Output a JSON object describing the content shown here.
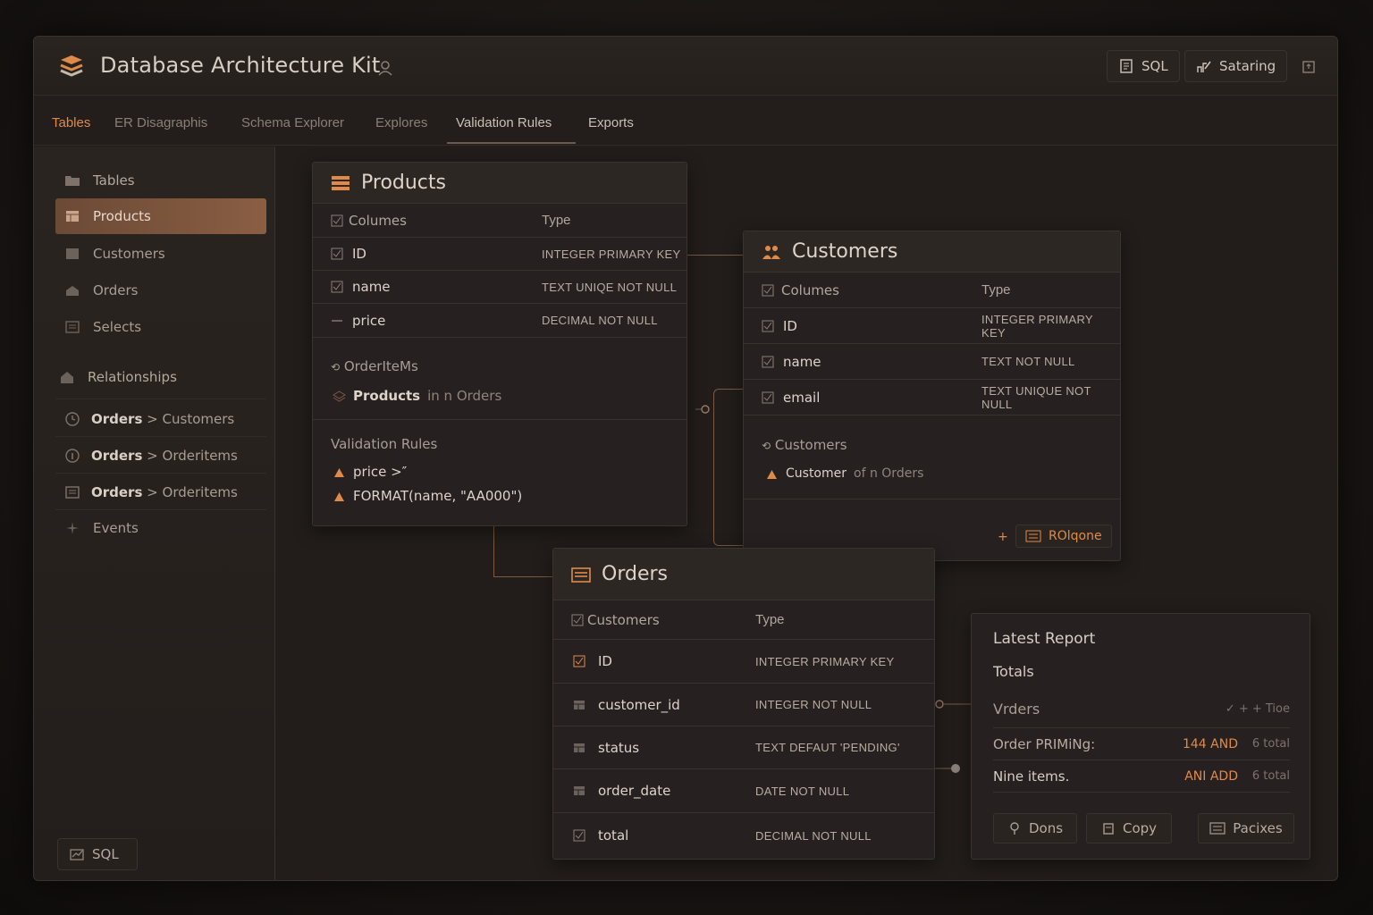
{
  "app": {
    "title": "Database Architecture Kit",
    "buttons": {
      "sql": "SQL",
      "sharing": "Sataring"
    }
  },
  "tabs": [
    {
      "label": "Tables",
      "active": true
    },
    {
      "label": "ER Disagraphis"
    },
    {
      "label": "Schema Explorer"
    },
    {
      "label": "Explores"
    },
    {
      "label": "Validation Rules"
    },
    {
      "label": "Exports"
    }
  ],
  "sidebar": {
    "items": [
      {
        "label": "Tables"
      },
      {
        "label": "Products",
        "active": true
      },
      {
        "label": "Customers"
      },
      {
        "label": "Orders"
      },
      {
        "label": "Selects"
      }
    ],
    "relationships_label": "Relationships",
    "relationships": [
      {
        "from": "Orders",
        "sep": ">",
        "to": "Customers"
      },
      {
        "from": "Orders",
        "sep": ">",
        "to": "Orderitems"
      },
      {
        "from": "Orders",
        "sep": ">",
        "to": "Orderitems"
      }
    ],
    "events_label": "Events",
    "sql_label": "SQL"
  },
  "products": {
    "title": "Products",
    "col_header": "Columes",
    "type_header": "Type",
    "rows": [
      {
        "name": "ID",
        "type": "INTEGER PRIMARY KEY"
      },
      {
        "name": "name",
        "type": "TEXT UNIQE NOT NULL"
      },
      {
        "name": "price",
        "type": "DECIMAL NOT NULL"
      }
    ],
    "rel_label": "OrderIteMs",
    "rel_bold": "Products",
    "rel_rest": "in n Orders",
    "validation_label": "Validation Rules",
    "rules": [
      "price >″",
      "FORMAT(name, \"AA000\")"
    ]
  },
  "customers": {
    "title": "Customers",
    "col_header": "Columes",
    "type_header": "Type",
    "rows": [
      {
        "name": "ID",
        "type": "INTEGER PRIMARY KEY"
      },
      {
        "name": "name",
        "type": "TEXT NOT NULL"
      },
      {
        "name": "email",
        "type": "TEXT UNIQUE NOT NULL"
      }
    ],
    "rel_label": "Customers",
    "rel_bold": "Customer",
    "rel_rest": "of n Orders",
    "add_sign": "+",
    "action_label": "ROlqone"
  },
  "orders": {
    "title": "Orders",
    "col_header": "Customers",
    "type_header": "Type",
    "rows": [
      {
        "name": "ID",
        "type": "INTEGER PRIMARY KEY"
      },
      {
        "name": "customer_id",
        "type": "INTEGER NOT NULL"
      },
      {
        "name": "status",
        "type": "TEXT DEFAUT 'PENDING'"
      },
      {
        "name": "order_date",
        "type": "DATE NOT NULL"
      },
      {
        "name": "total",
        "type": "DECIMAL NOT NULL"
      }
    ]
  },
  "report": {
    "title": "Latest Report",
    "subtitle": "Totals",
    "header_label": "Vrders",
    "header_controls": "✓ + + Tioe",
    "rows": [
      {
        "label": "Order PRIMiNg:",
        "value": "144 AND",
        "total": "6 total"
      },
      {
        "label": "Nine items.",
        "value": "ANI ADD",
        "total": "6 total"
      }
    ],
    "buttons": [
      "Dons",
      "Copy",
      "Pacixes"
    ]
  },
  "colors": {
    "accent": "#e08a4a",
    "line": "#7a5a45"
  }
}
